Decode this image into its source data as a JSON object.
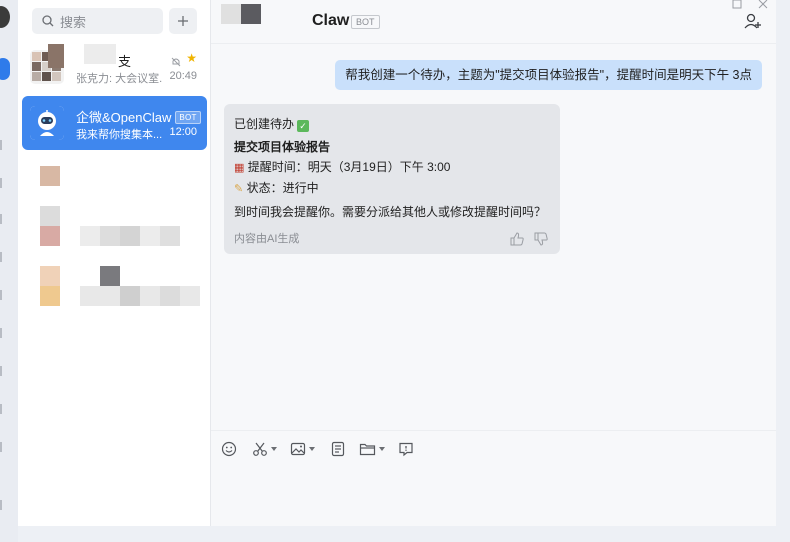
{
  "sidebar": {
    "search_placeholder": "搜索",
    "conversations": [
      {
        "title": "支",
        "subtitle": "张克力: 大会议室...",
        "time": "20:49"
      },
      {
        "title": "企微&OpenClaw",
        "badge": "BOT",
        "subtitle": "我来帮你搜集本...",
        "time": "12:00"
      }
    ]
  },
  "chat": {
    "title": "Claw",
    "badge": "BOT",
    "outgoing_message": "帮我创建一个待办，主题为\"提交项目体验报告\"，提醒时间是明天下午 3点",
    "reply": {
      "line1": "已创建待办",
      "heading": "提交项目体验报告",
      "reminder": "提醒时间：明天（3月19日）下午 3:00",
      "status": "状态：进行中",
      "question": "到时间我会提醒你。需要分派给其他人或修改提醒时间吗？",
      "ai_note": "内容由AI生成"
    }
  },
  "colors": {
    "accent": "#3f87ee",
    "outgoing_bubble": "#c9e0fb",
    "incoming_bubble": "#e4e6ea"
  },
  "toolbar_icons": [
    "emoji-icon",
    "scissors-icon",
    "image-icon",
    "document-icon",
    "folder-icon",
    "chat-record-icon"
  ]
}
